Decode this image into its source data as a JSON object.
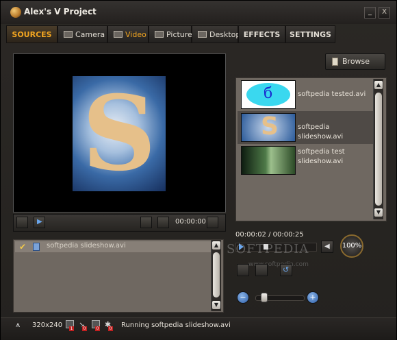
{
  "window": {
    "title": "Alex's V Project",
    "minimize": "_",
    "close": "X"
  },
  "tabs": [
    {
      "label": "SOURCES"
    },
    {
      "label": "Camera"
    },
    {
      "label": "Video"
    },
    {
      "label": "Picture"
    },
    {
      "label": "Desktop"
    },
    {
      "label": "EFFECTS"
    },
    {
      "label": "SETTINGS"
    }
  ],
  "preview": {
    "time": "00:00:00"
  },
  "playlist": {
    "items": [
      {
        "name": "softpedia slideshow.avi",
        "checked": true
      }
    ]
  },
  "browse": {
    "label": "Browse"
  },
  "files": [
    {
      "name": "softpedia tested.avi"
    },
    {
      "name": "softpedia slideshow.avi"
    },
    {
      "name": "softpedia test slideshow.avi"
    }
  ],
  "player": {
    "position": "00:00:02 / 00:00:25",
    "volume": "100%"
  },
  "watermark": {
    "brand": "SOFTPEDIA",
    "url": "www.softpedia.com"
  },
  "status": {
    "resolution": "320x240",
    "counters": [
      "1",
      "0",
      "0",
      "0"
    ],
    "message": "Running softpedia slideshow.avi"
  },
  "colors": {
    "accent": "#f2a520",
    "background": "#24221f"
  }
}
